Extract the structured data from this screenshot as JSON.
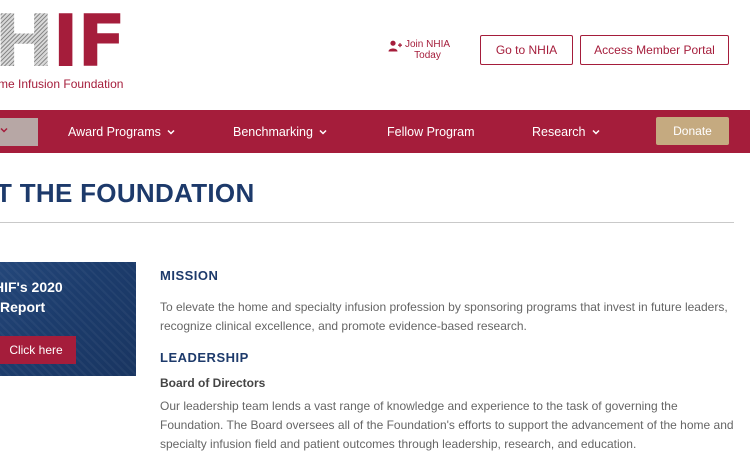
{
  "logo": {
    "letters": [
      "H",
      "I",
      "F"
    ],
    "name": "me Infusion Foundation"
  },
  "header": {
    "join": {
      "icon": "user-plus-icon",
      "line1": "Join NHIA",
      "line2": "Today"
    },
    "go_nhia": "Go to NHIA",
    "member_portal": "Access Member Portal"
  },
  "nav": {
    "items": [
      {
        "label": "Award Programs",
        "dropdown": true
      },
      {
        "label": "Benchmarking",
        "dropdown": true
      },
      {
        "label": "Fellow Program",
        "dropdown": false
      },
      {
        "label": "Research",
        "dropdown": true
      }
    ],
    "donate": "Donate"
  },
  "page": {
    "title": "T THE FOUNDATION"
  },
  "promo": {
    "line1": "HIF's 2020",
    "line2": "Report",
    "button": "Click here"
  },
  "content": {
    "mission_heading": "MISSION",
    "mission_text": "To elevate the home and specialty infusion profession by sponsoring programs that invest in future leaders, recognize clinical excellence, and promote evidence-based research.",
    "leadership_heading": "LEADERSHIP",
    "board_heading": "Board of Directors",
    "board_text": "Our leadership team lends a vast range of knowledge and experience to the task of governing the Foundation. The Board oversees all of the Foundation's efforts to support the advancement of the home and specialty infusion field and patient outcomes through leadership, research, and education."
  },
  "colors": {
    "brand_red": "#a51d3b",
    "navy": "#1d3a6b",
    "donate_gold": "#c5aa80"
  }
}
